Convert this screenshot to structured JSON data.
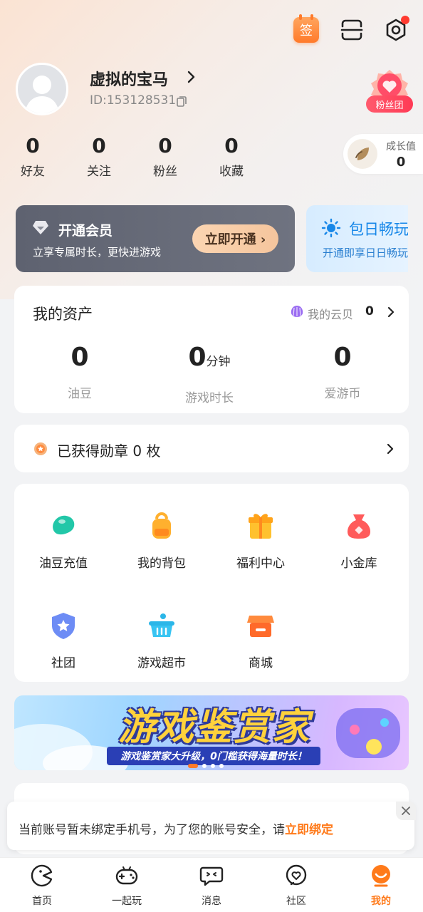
{
  "header": {
    "sign_label": "签",
    "icons": [
      "sign-in-icon",
      "scan-icon",
      "settings-icon"
    ],
    "settings_has_notification": true
  },
  "profile": {
    "username": "虚拟的宝马",
    "user_id": "ID:153128531",
    "fan_group_label": "粉丝团"
  },
  "stats": [
    {
      "value": "0",
      "label": "好友"
    },
    {
      "value": "0",
      "label": "关注"
    },
    {
      "value": "0",
      "label": "粉丝"
    },
    {
      "value": "0",
      "label": "收藏"
    }
  ],
  "growth": {
    "label": "成长值",
    "value": "0"
  },
  "vip": {
    "title": "开通会员",
    "subtitle": "立享专属时长，更快进游戏",
    "button_label": "立即开通 ›"
  },
  "daily_pass": {
    "title": "包日畅玩",
    "subtitle": "开通即享日日畅玩"
  },
  "assets": {
    "title": "我的资产",
    "cloud_shell_label": "我的云贝",
    "cloud_shell_value": "0",
    "items": [
      {
        "value": "0",
        "unit": "",
        "label": "油豆"
      },
      {
        "value": "0",
        "unit": "分钟",
        "label": "游戏时长"
      },
      {
        "value": "0",
        "unit": "",
        "label": "爱游币"
      }
    ]
  },
  "medals": {
    "text": "已获得勋章 0 枚"
  },
  "services": [
    {
      "label": "油豆充值",
      "icon": "bean-icon"
    },
    {
      "label": "我的背包",
      "icon": "backpack-icon"
    },
    {
      "label": "福利中心",
      "icon": "gift-icon"
    },
    {
      "label": "小金库",
      "icon": "money-bag-icon"
    },
    {
      "label": "社团",
      "icon": "club-shield-icon"
    },
    {
      "label": "游戏超市",
      "icon": "basket-icon"
    },
    {
      "label": "商城",
      "icon": "store-icon"
    }
  ],
  "banner": {
    "title": "游戏鉴赏家",
    "subtitle": "游戏鉴赏家大升级，0门槛获得海量时长！"
  },
  "notice": {
    "text": "当前账号暂未绑定手机号，为了您的账号安全，请",
    "link": "立即绑定"
  },
  "tabs": [
    {
      "label": "首页",
      "icon": "home-icon"
    },
    {
      "label": "一起玩",
      "icon": "gamepad-icon"
    },
    {
      "label": "消息",
      "icon": "message-icon"
    },
    {
      "label": "社区",
      "icon": "community-icon"
    },
    {
      "label": "我的",
      "icon": "profile-icon",
      "active": true
    }
  ],
  "colors": {
    "accent": "#ff7a1a",
    "vip_card": "#5e6270",
    "vip_button": "#f7cda8",
    "daily_blue": "#1787e8",
    "badge_red": "#ff3a55"
  }
}
